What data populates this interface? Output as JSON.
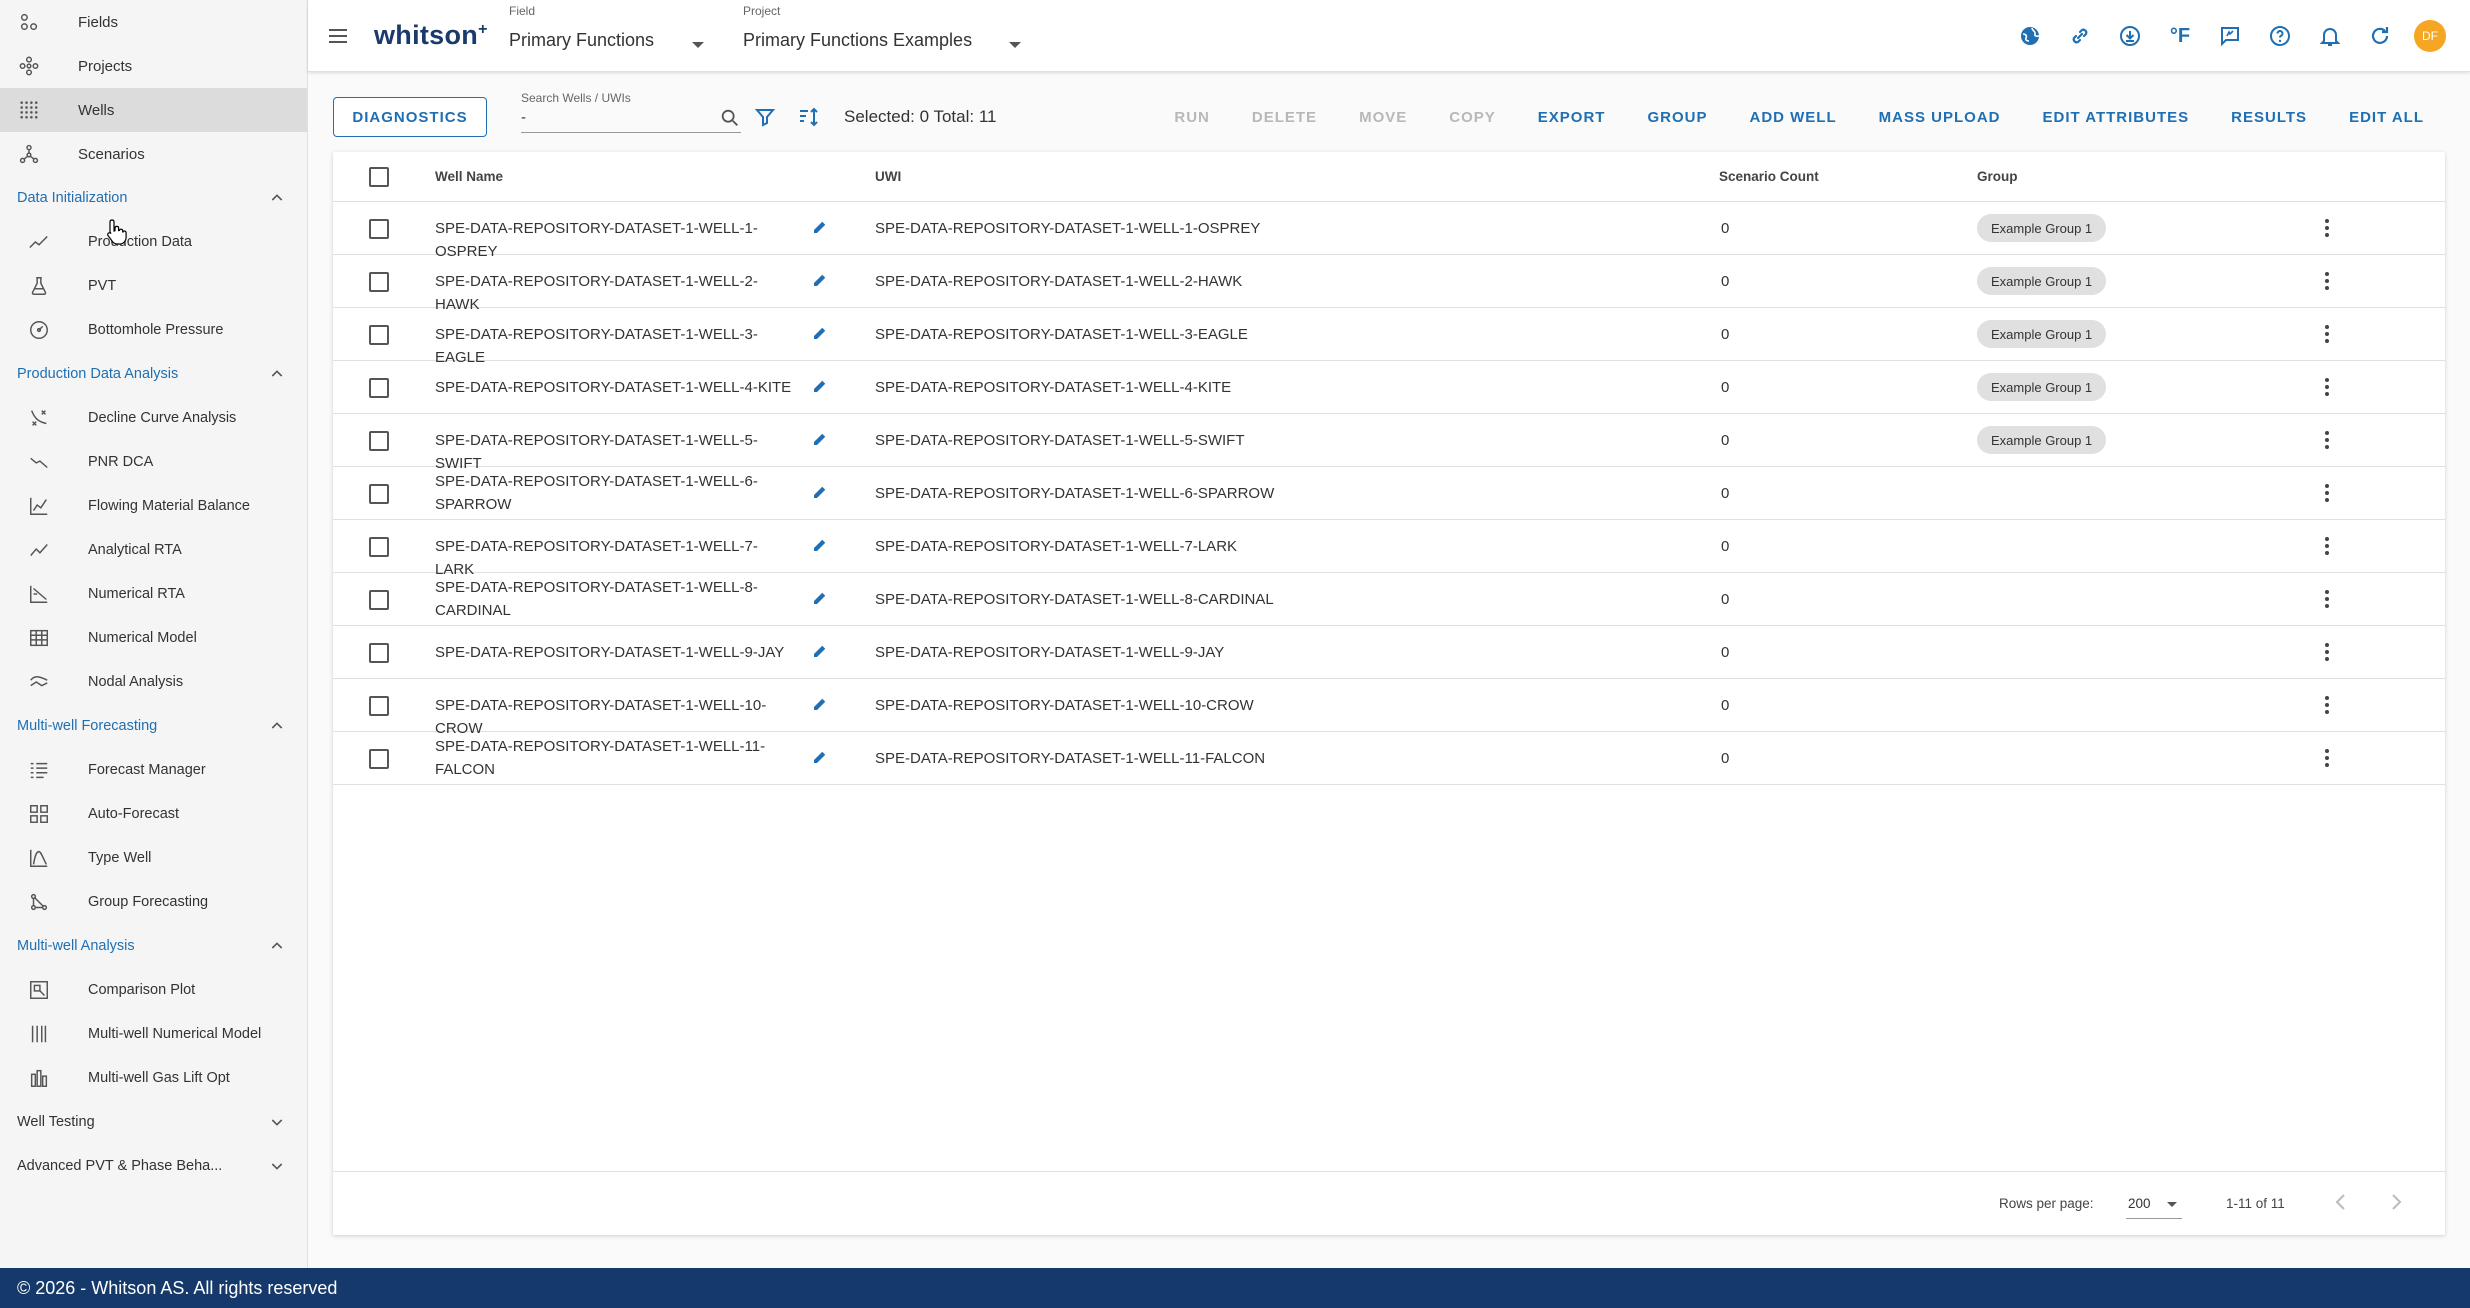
{
  "sidebar": {
    "top": [
      {
        "label": "Fields",
        "icon": "fields-icon"
      },
      {
        "label": "Projects",
        "icon": "projects-icon"
      },
      {
        "label": "Wells",
        "icon": "wells-icon",
        "active": true
      },
      {
        "label": "Scenarios",
        "icon": "scenarios-icon"
      }
    ],
    "sections": [
      {
        "title": "Data Initialization",
        "expanded": true,
        "items": [
          {
            "label": "Production Data",
            "icon": "production-data-icon"
          },
          {
            "label": "PVT",
            "icon": "pvt-icon"
          },
          {
            "label": "Bottomhole Pressure",
            "icon": "gauge-icon"
          }
        ]
      },
      {
        "title": "Production Data Analysis",
        "expanded": true,
        "items": [
          {
            "label": "Decline Curve Analysis",
            "icon": "decline-curve-icon"
          },
          {
            "label": "PNR DCA",
            "icon": "pnr-dca-icon"
          },
          {
            "label": "Flowing Material Balance",
            "icon": "material-balance-icon"
          },
          {
            "label": "Analytical RTA",
            "icon": "analytical-rta-icon"
          },
          {
            "label": "Numerical RTA",
            "icon": "numerical-rta-icon"
          },
          {
            "label": "Numerical Model",
            "icon": "numerical-model-icon"
          },
          {
            "label": "Nodal Analysis",
            "icon": "nodal-analysis-icon"
          }
        ]
      },
      {
        "title": "Multi-well Forecasting",
        "expanded": true,
        "items": [
          {
            "label": "Forecast Manager",
            "icon": "forecast-manager-icon"
          },
          {
            "label": "Auto-Forecast",
            "icon": "auto-forecast-icon"
          },
          {
            "label": "Type Well",
            "icon": "type-well-icon"
          },
          {
            "label": "Group Forecasting",
            "icon": "group-forecasting-icon"
          }
        ]
      },
      {
        "title": "Multi-well Analysis",
        "expanded": true,
        "items": [
          {
            "label": "Comparison Plot",
            "icon": "comparison-plot-icon"
          },
          {
            "label": "Multi-well Numerical Model",
            "icon": "multiwell-model-icon"
          },
          {
            "label": "Multi-well Gas Lift Opt",
            "icon": "gas-lift-icon"
          }
        ]
      },
      {
        "title": "Well Testing",
        "expanded": false,
        "items": []
      },
      {
        "title": "Advanced PVT & Phase Beha...",
        "expanded": false,
        "items": []
      }
    ]
  },
  "header": {
    "logo": "whitson",
    "logo_sup": "+",
    "field_label": "Field",
    "field_value": "Primary Functions",
    "project_label": "Project",
    "project_value": "Primary Functions Examples",
    "temp_unit": "°F",
    "avatar_initials": "DF",
    "accent": "#1f6fb2",
    "avatar_color": "#f5a623"
  },
  "toolbar": {
    "diagnostics": "DIAGNOSTICS",
    "search_label": "Search Wells / UWIs",
    "search_value": "-",
    "selected_total": "Selected: 0 Total: 11",
    "actions": [
      {
        "label": "RUN",
        "enabled": false
      },
      {
        "label": "DELETE",
        "enabled": false
      },
      {
        "label": "MOVE",
        "enabled": false
      },
      {
        "label": "COPY",
        "enabled": false
      },
      {
        "label": "EXPORT",
        "enabled": true
      },
      {
        "label": "GROUP",
        "enabled": true
      },
      {
        "label": "ADD WELL",
        "enabled": true
      },
      {
        "label": "MASS UPLOAD",
        "enabled": true
      },
      {
        "label": "EDIT ATTRIBUTES",
        "enabled": true
      },
      {
        "label": "RESULTS",
        "enabled": true
      },
      {
        "label": "EDIT ALL",
        "enabled": true
      }
    ]
  },
  "table": {
    "columns": [
      "Well Name",
      "UWI",
      "Scenario Count",
      "Group"
    ],
    "rows": [
      {
        "name": [
          "SPE-DATA-REPOSITORY-DATASET-1-WELL-1-OSPREY"
        ],
        "uwi": "SPE-DATA-REPOSITORY-DATASET-1-WELL-1-OSPREY",
        "count": "0",
        "group": "Example Group 1"
      },
      {
        "name": [
          "SPE-DATA-REPOSITORY-DATASET-1-WELL-2-HAWK"
        ],
        "uwi": "SPE-DATA-REPOSITORY-DATASET-1-WELL-2-HAWK",
        "count": "0",
        "group": "Example Group 1"
      },
      {
        "name": [
          "SPE-DATA-REPOSITORY-DATASET-1-WELL-3-EAGLE"
        ],
        "uwi": "SPE-DATA-REPOSITORY-DATASET-1-WELL-3-EAGLE",
        "count": "0",
        "group": "Example Group 1"
      },
      {
        "name": [
          "SPE-DATA-REPOSITORY-DATASET-1-WELL-4-KITE"
        ],
        "uwi": "SPE-DATA-REPOSITORY-DATASET-1-WELL-4-KITE",
        "count": "0",
        "group": "Example Group 1"
      },
      {
        "name": [
          "SPE-DATA-REPOSITORY-DATASET-1-WELL-5-SWIFT"
        ],
        "uwi": "SPE-DATA-REPOSITORY-DATASET-1-WELL-5-SWIFT",
        "count": "0",
        "group": "Example Group 1"
      },
      {
        "name": [
          "SPE-DATA-REPOSITORY-DATASET-1-WELL-6-",
          "SPARROW"
        ],
        "uwi": "SPE-DATA-REPOSITORY-DATASET-1-WELL-6-SPARROW",
        "count": "0",
        "group": ""
      },
      {
        "name": [
          "SPE-DATA-REPOSITORY-DATASET-1-WELL-7-LARK"
        ],
        "uwi": "SPE-DATA-REPOSITORY-DATASET-1-WELL-7-LARK",
        "count": "0",
        "group": ""
      },
      {
        "name": [
          "SPE-DATA-REPOSITORY-DATASET-1-WELL-8-",
          "CARDINAL"
        ],
        "uwi": "SPE-DATA-REPOSITORY-DATASET-1-WELL-8-CARDINAL",
        "count": "0",
        "group": ""
      },
      {
        "name": [
          "SPE-DATA-REPOSITORY-DATASET-1-WELL-9-JAY"
        ],
        "uwi": "SPE-DATA-REPOSITORY-DATASET-1-WELL-9-JAY",
        "count": "0",
        "group": ""
      },
      {
        "name": [
          "SPE-DATA-REPOSITORY-DATASET-1-WELL-10-CROW"
        ],
        "uwi": "SPE-DATA-REPOSITORY-DATASET-1-WELL-10-CROW",
        "count": "0",
        "group": ""
      },
      {
        "name": [
          "SPE-DATA-REPOSITORY-DATASET-1-WELL-11-",
          "FALCON"
        ],
        "uwi": "SPE-DATA-REPOSITORY-DATASET-1-WELL-11-FALCON",
        "count": "0",
        "group": ""
      }
    ]
  },
  "pagination": {
    "rows_per_page_label": "Rows per page:",
    "rows_per_page": "200",
    "range": "1-11 of 11"
  },
  "footer": {
    "copyright": "© 2026 - Whitson AS. All rights reserved"
  }
}
